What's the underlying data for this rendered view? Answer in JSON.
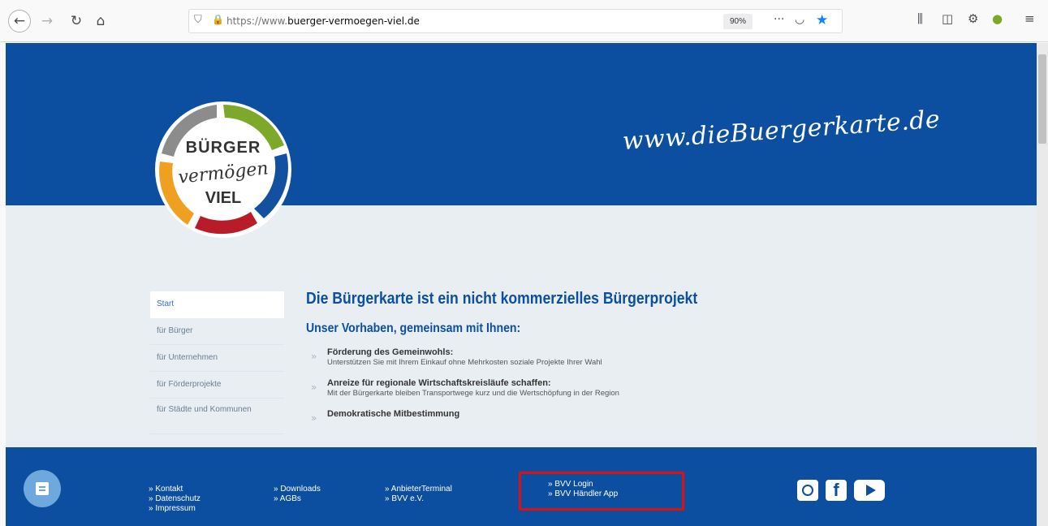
{
  "browser": {
    "url_protocol": "https://www.",
    "url_domain": "buerger-vermoegen-viel.de",
    "zoom": "90%",
    "more_label": "···"
  },
  "header": {
    "tagline": "www.dieBuergerkarte.de",
    "logo": {
      "line1": "BÜRGER",
      "line2": "vermögen",
      "line3": "VIEL"
    }
  },
  "sidebar": {
    "items": [
      {
        "label": "Start"
      },
      {
        "label": "für Bürger"
      },
      {
        "label": "für Unternehmen"
      },
      {
        "label": "für Förderprojekte"
      },
      {
        "label": "für Städte und Kommunen"
      }
    ]
  },
  "main": {
    "title": "Die Bürgerkarte ist ein nicht kommerzielles Bürgerprojekt",
    "subtitle": "Unser Vorhaben, gemeinsam mit Ihnen:",
    "bullets": [
      {
        "title": "Förderung des Gemeinwohls:",
        "desc": "Unterstützen Sie mit Ihrem Einkauf ohne Mehrkosten soziale Projekte Ihrer Wahl"
      },
      {
        "title": "Anreize  für regionale Wirtschaftskreisläufe schaffen:",
        "desc": "Mit der Bürgerkarte bleiben Transportwege kurz und die Wertschöpfung in der Region"
      },
      {
        "title": "Demokratische Mitbestimmung",
        "desc": ""
      }
    ]
  },
  "footer": {
    "col1": [
      "» Kontakt",
      "» Datenschutz",
      "» Impressum"
    ],
    "col2": [
      "» Downloads",
      "» AGBs"
    ],
    "col3": [
      "» AnbieterTerminal",
      "» BVV e.V."
    ],
    "col4": [
      "» BVV Login",
      "» BVV Händler App"
    ]
  },
  "colors": {
    "brand_blue": "#0c4fa0",
    "highlight_red": "#e01010",
    "logo_green": "#7ea82a",
    "logo_orange": "#f0a020",
    "logo_red": "#b81c28",
    "logo_gray": "#8c8c8c"
  }
}
